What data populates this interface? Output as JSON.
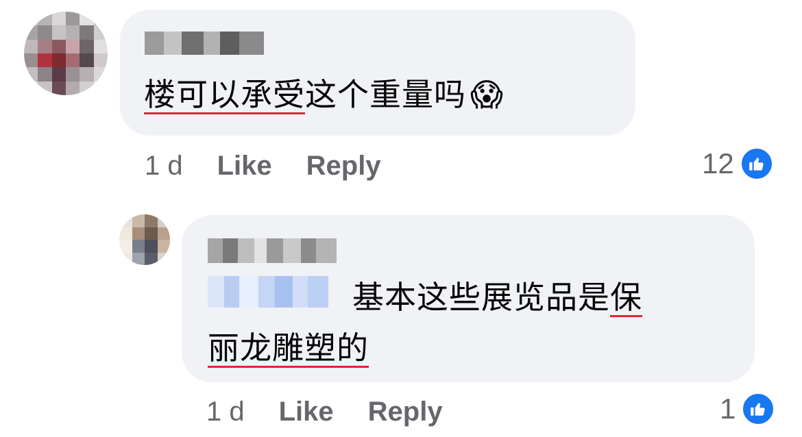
{
  "comments": [
    {
      "time": "1 d",
      "like_label": "Like",
      "reply_label": "Reply",
      "text_underlined": "楼可以承受",
      "text_rest": "这个重量吗",
      "emoji": "😱",
      "reaction_count": "12",
      "reaction_icon": "thumbs-up-icon"
    },
    {
      "time": "1 d",
      "like_label": "Like",
      "reply_label": "Reply",
      "text_line1": "基本这些展览品是",
      "text_line1_underlined": "保",
      "text_line2_underlined": "丽龙雕塑的",
      "reaction_count": "1",
      "reaction_icon": "thumbs-up-icon"
    }
  ],
  "colors": {
    "bubble": "#f0f2f5",
    "meta_text": "#65676b",
    "like_blue": "#1877f2",
    "spell_underline": "#e0243a"
  }
}
